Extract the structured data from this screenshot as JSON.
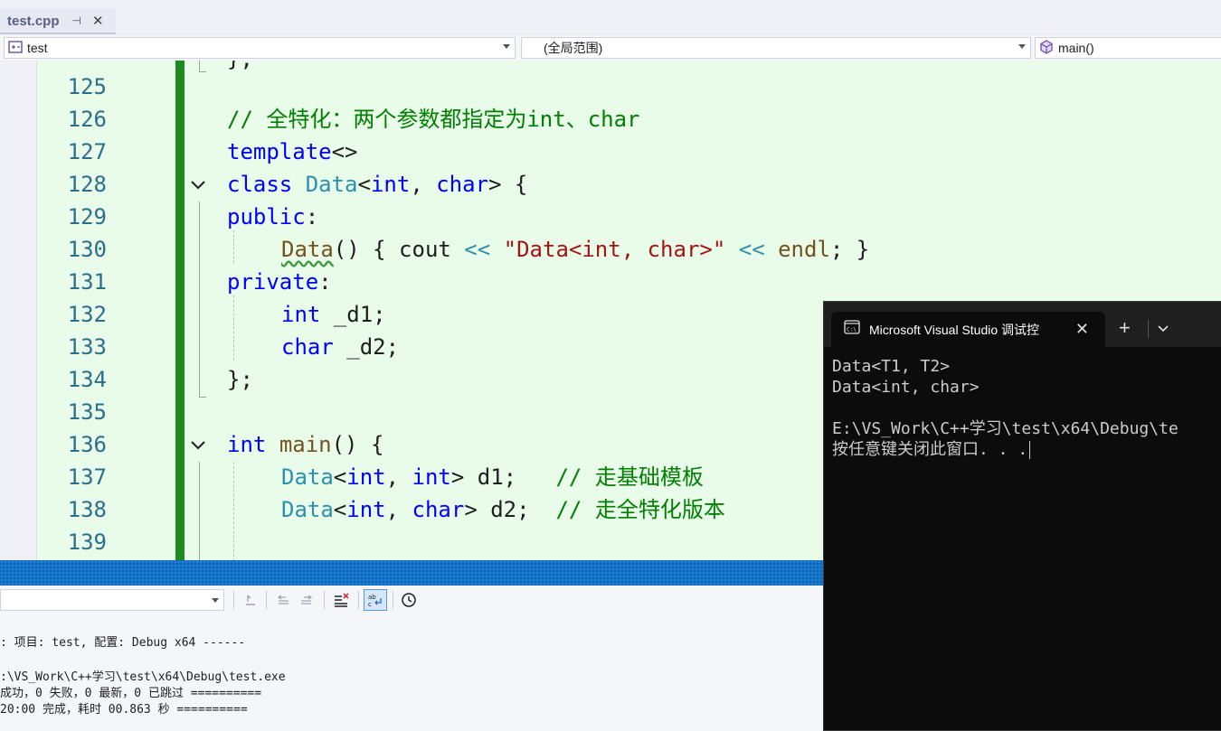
{
  "tab": {
    "title": "test.cpp",
    "pin": "⊣",
    "close": "✕"
  },
  "navbar": {
    "project": "test",
    "scope": "(全局范围)",
    "member": "main()"
  },
  "editor": {
    "prev_line_fragment": "};",
    "line_numbers": [
      "125",
      "126",
      "127",
      "128",
      "129",
      "130",
      "131",
      "132",
      "133",
      "134",
      "135",
      "136",
      "137",
      "138",
      "139"
    ],
    "code": {
      "l126_comment": "// 全特化：两个参数都指定为int、char",
      "l127_kw": "template",
      "l127_rest": "<>",
      "l128_kw": "class",
      "l128_type": "Data",
      "l128_lt": "<",
      "l128_int": "int",
      "l128_comma": ", ",
      "l128_char": "char",
      "l128_rest": "> {",
      "l129_kw": "public",
      "l129_colon": ":",
      "l130_fn": "Data",
      "l130_a": "() { cout ",
      "l130_op1": "<<",
      "l130_str": "\"Data<int, char>\"",
      "l130_op2": "<<",
      "l130_endl": "endl",
      "l130_b": "; }",
      "l131_kw": "private",
      "l131_colon": ":",
      "l132_kw": "int",
      "l132_rest": " _d1;",
      "l133_kw": "char",
      "l133_rest": " _d2;",
      "l134": "};",
      "l136_kw": "int",
      "l136_fn": "main",
      "l136_rest": "() {",
      "l137_type": "Data",
      "l137_lt": "<",
      "l137_int1": "int",
      "l137_comma": ", ",
      "l137_int2": "int",
      "l137_rest": "> d1;   ",
      "l137_comment": "// 走基础模板",
      "l138_type": "Data",
      "l138_lt": "<",
      "l138_int": "int",
      "l138_comma": ", ",
      "l138_char": "char",
      "l138_rest": "> d2;  ",
      "l138_comment": "// 走全特化版本"
    }
  },
  "output": {
    "lines": [
      ": 项目: test, 配置: Debug x64 ------",
      ":\\VS_Work\\C++学习\\test\\x64\\Debug\\test.exe",
      "成功，0 失败，0 最新，0 已跳过 ==========",
      "20:00 完成，耗时 00.863 秒 =========="
    ]
  },
  "console": {
    "title": "Microsoft Visual Studio 调试控",
    "close": "✕",
    "plus": "+",
    "lines": [
      "Data<T1, T2>",
      "Data<int, char>",
      "",
      "E:\\VS_Work\\C++学习\\test\\x64\\Debug\\te",
      "按任意键关闭此窗口. . ."
    ]
  },
  "colors": {
    "editor_bg": "#e9fbe9",
    "change_bar": "#1f8a1f",
    "keyword": "#0000ff",
    "type": "#2b91af",
    "comment": "#008000",
    "string": "#a31515",
    "function": "#74531f",
    "line_number": "#2b6f8d",
    "separator": "#0e6cc2",
    "console_bg": "#0c0c0c"
  }
}
